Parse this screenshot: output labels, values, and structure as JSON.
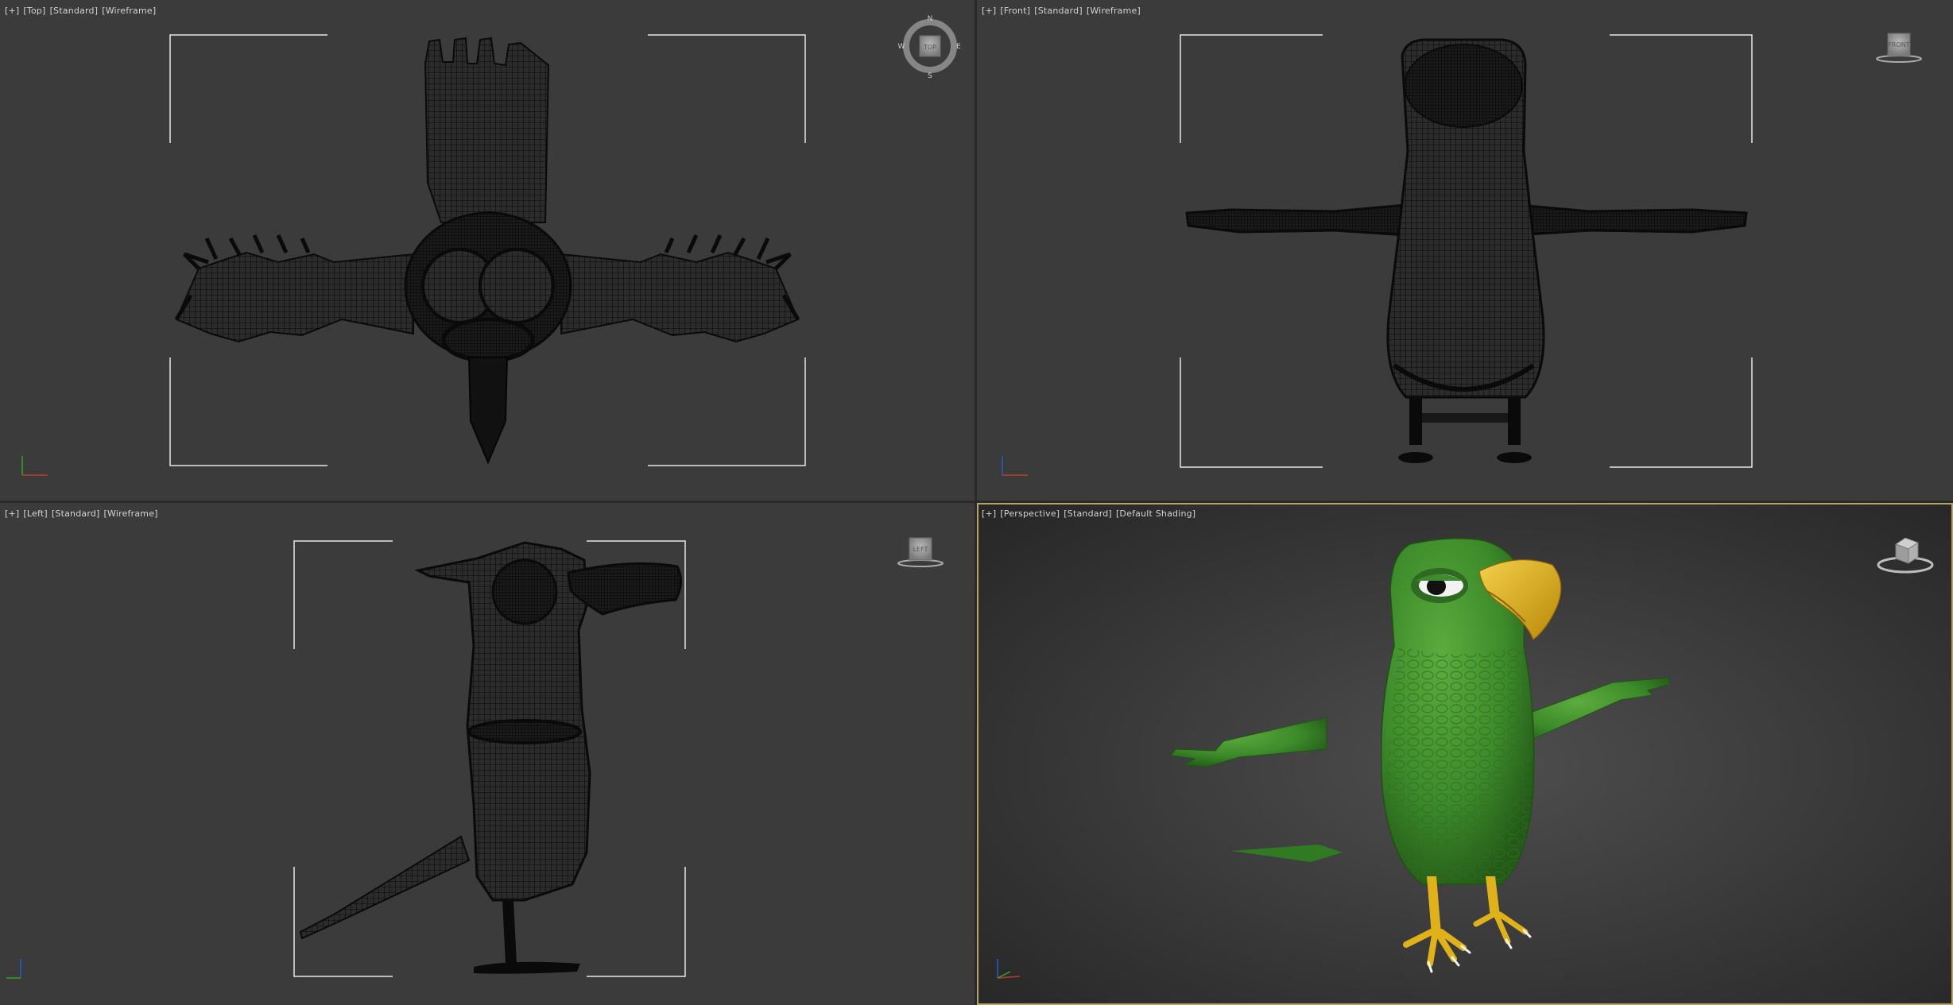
{
  "viewports": {
    "top": {
      "label": {
        "plus": "[+]",
        "view": "[Top]",
        "preset": "[Standard]",
        "shading": "[Wireframe]"
      },
      "viewcube": {
        "face": "TOP",
        "n": "N",
        "s": "S",
        "e": "E",
        "w": "W"
      }
    },
    "front": {
      "label": {
        "plus": "[+]",
        "view": "[Front]",
        "preset": "[Standard]",
        "shading": "[Wireframe]"
      },
      "viewcube": {
        "face": "FRONT"
      }
    },
    "left": {
      "label": {
        "plus": "[+]",
        "view": "[Left]",
        "preset": "[Standard]",
        "shading": "[Wireframe]"
      },
      "viewcube": {
        "face": "LEFT"
      }
    },
    "perspective": {
      "label": {
        "plus": "[+]",
        "view": "[Perspective]",
        "preset": "[Standard]",
        "shading": "[Default Shading]"
      },
      "viewcube": {
        "face": ""
      },
      "active": true
    }
  },
  "colors": {
    "viewport_bg": "#3b3b3b",
    "wireframe": "#0d0d0d",
    "parrot_green": "#3e8a2e",
    "beak_yellow": "#e0b21a",
    "active_border": "#b8a464",
    "safe_frame": "#e6e6e6",
    "axis_x": "#c03a2b",
    "axis_y": "#3aa02b",
    "axis_z": "#2b5bc0"
  },
  "icons": [
    "viewcube-icon",
    "compass-ring-icon",
    "axis-tripod-icon"
  ]
}
